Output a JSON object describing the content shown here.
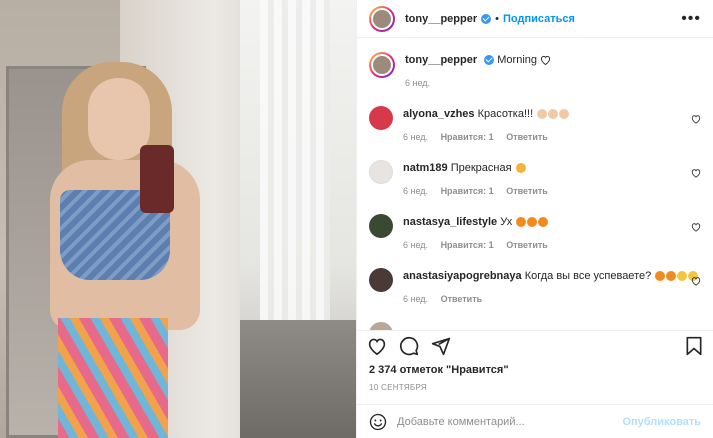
{
  "post": {
    "author": "tony__pepper",
    "follow_label": "Подписаться",
    "dot": "•",
    "more_label": "•••",
    "caption_text": "Morning",
    "caption_time": "6 нед."
  },
  "comments": [
    {
      "user": "alyona_vzhes",
      "text": "Красотка!!!",
      "time": "6 нед.",
      "likes": "Нравится: 1",
      "reply": "Ответить",
      "avatar_color": "#d63a4a"
    },
    {
      "user": "natm189",
      "text": "Прекрасная",
      "time": "6 нед.",
      "likes": "Нравится: 1",
      "reply": "Ответить",
      "avatar_color": "#e9e4df"
    },
    {
      "user": "nastasya_lifestyle",
      "text": "Ух",
      "time": "6 нед.",
      "likes": "Нравится: 1",
      "reply": "Ответить",
      "avatar_color": "#3a4a32"
    },
    {
      "user": "anastasiyapogrebnaya",
      "text": "Когда вы все успеваете?",
      "time": "6 нед.",
      "likes": "",
      "reply": "Ответить",
      "avatar_color": "#4a3a36"
    }
  ],
  "stats": {
    "likes": "2 374 отметок \"Нравится\"",
    "date": "10 СЕНТЯБРЯ"
  },
  "composer": {
    "placeholder": "Добавьте комментарий...",
    "publish_label": "Опубликовать"
  },
  "colors": {
    "accent": "#0095f6",
    "muted": "#8e8e8e",
    "publish_disabled": "#b2dffc"
  }
}
